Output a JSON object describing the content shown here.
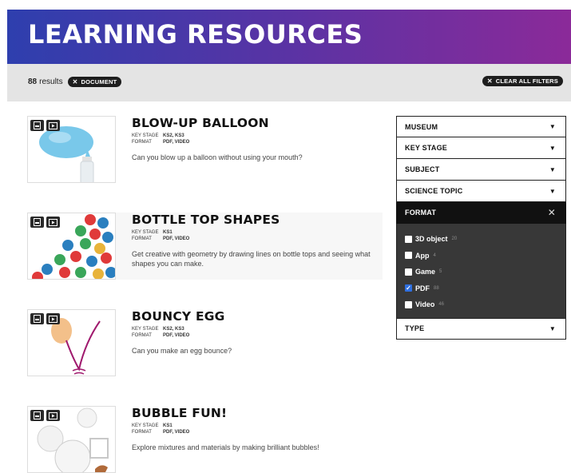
{
  "header": {
    "title": "LEARNING RESOURCES"
  },
  "filterbar": {
    "results_count": "88",
    "results_label": "results",
    "active_filter": "DOCUMENT",
    "clear_all": "CLEAR ALL FILTERS"
  },
  "cards": [
    {
      "title": "BLOW-UP BALLOON",
      "key_stage_label": "KEY STAGE",
      "key_stage": "KS2, KS3",
      "format_label": "FORMAT",
      "format": "PDF, VIDEO",
      "description": "Can you blow up a balloon without using your mouth?"
    },
    {
      "title": "BOTTLE TOP SHAPES",
      "key_stage_label": "KEY STAGE",
      "key_stage": "KS1",
      "format_label": "FORMAT",
      "format": "PDF, VIDEO",
      "description": "Get creative with geometry by drawing lines on bottle tops and seeing what shapes you can make."
    },
    {
      "title": "BOUNCY EGG",
      "key_stage_label": "KEY STAGE",
      "key_stage": "KS2, KS3",
      "format_label": "FORMAT",
      "format": "PDF, VIDEO",
      "description": "Can you make an egg bounce?"
    },
    {
      "title": "BUBBLE FUN!",
      "key_stage_label": "KEY STAGE",
      "key_stage": "KS1",
      "format_label": "FORMAT",
      "format": "PDF, VIDEO",
      "description": "Explore mixtures and materials by making brilliant bubbles!"
    }
  ],
  "sidebar": {
    "museum": "MUSEUM",
    "key_stage": "KEY STAGE",
    "subject": "SUBJECT",
    "science_topic": "SCIENCE TOPIC",
    "format": "FORMAT",
    "type": "TYPE",
    "format_options": [
      {
        "label": "3D object",
        "count": "20",
        "checked": false
      },
      {
        "label": "App",
        "count": "4",
        "checked": false
      },
      {
        "label": "Game",
        "count": "5",
        "checked": false
      },
      {
        "label": "PDF",
        "count": "88",
        "checked": true
      },
      {
        "label": "Video",
        "count": "46",
        "checked": false
      }
    ]
  },
  "colors": {
    "banner_start": "#2e3fae",
    "banner_end": "#8b2a99",
    "checkbox_on": "#2f6fe0"
  },
  "icons": {
    "doc": "document-icon",
    "video": "video-icon",
    "dropdown": "triangle-down-icon",
    "close": "close-icon"
  }
}
